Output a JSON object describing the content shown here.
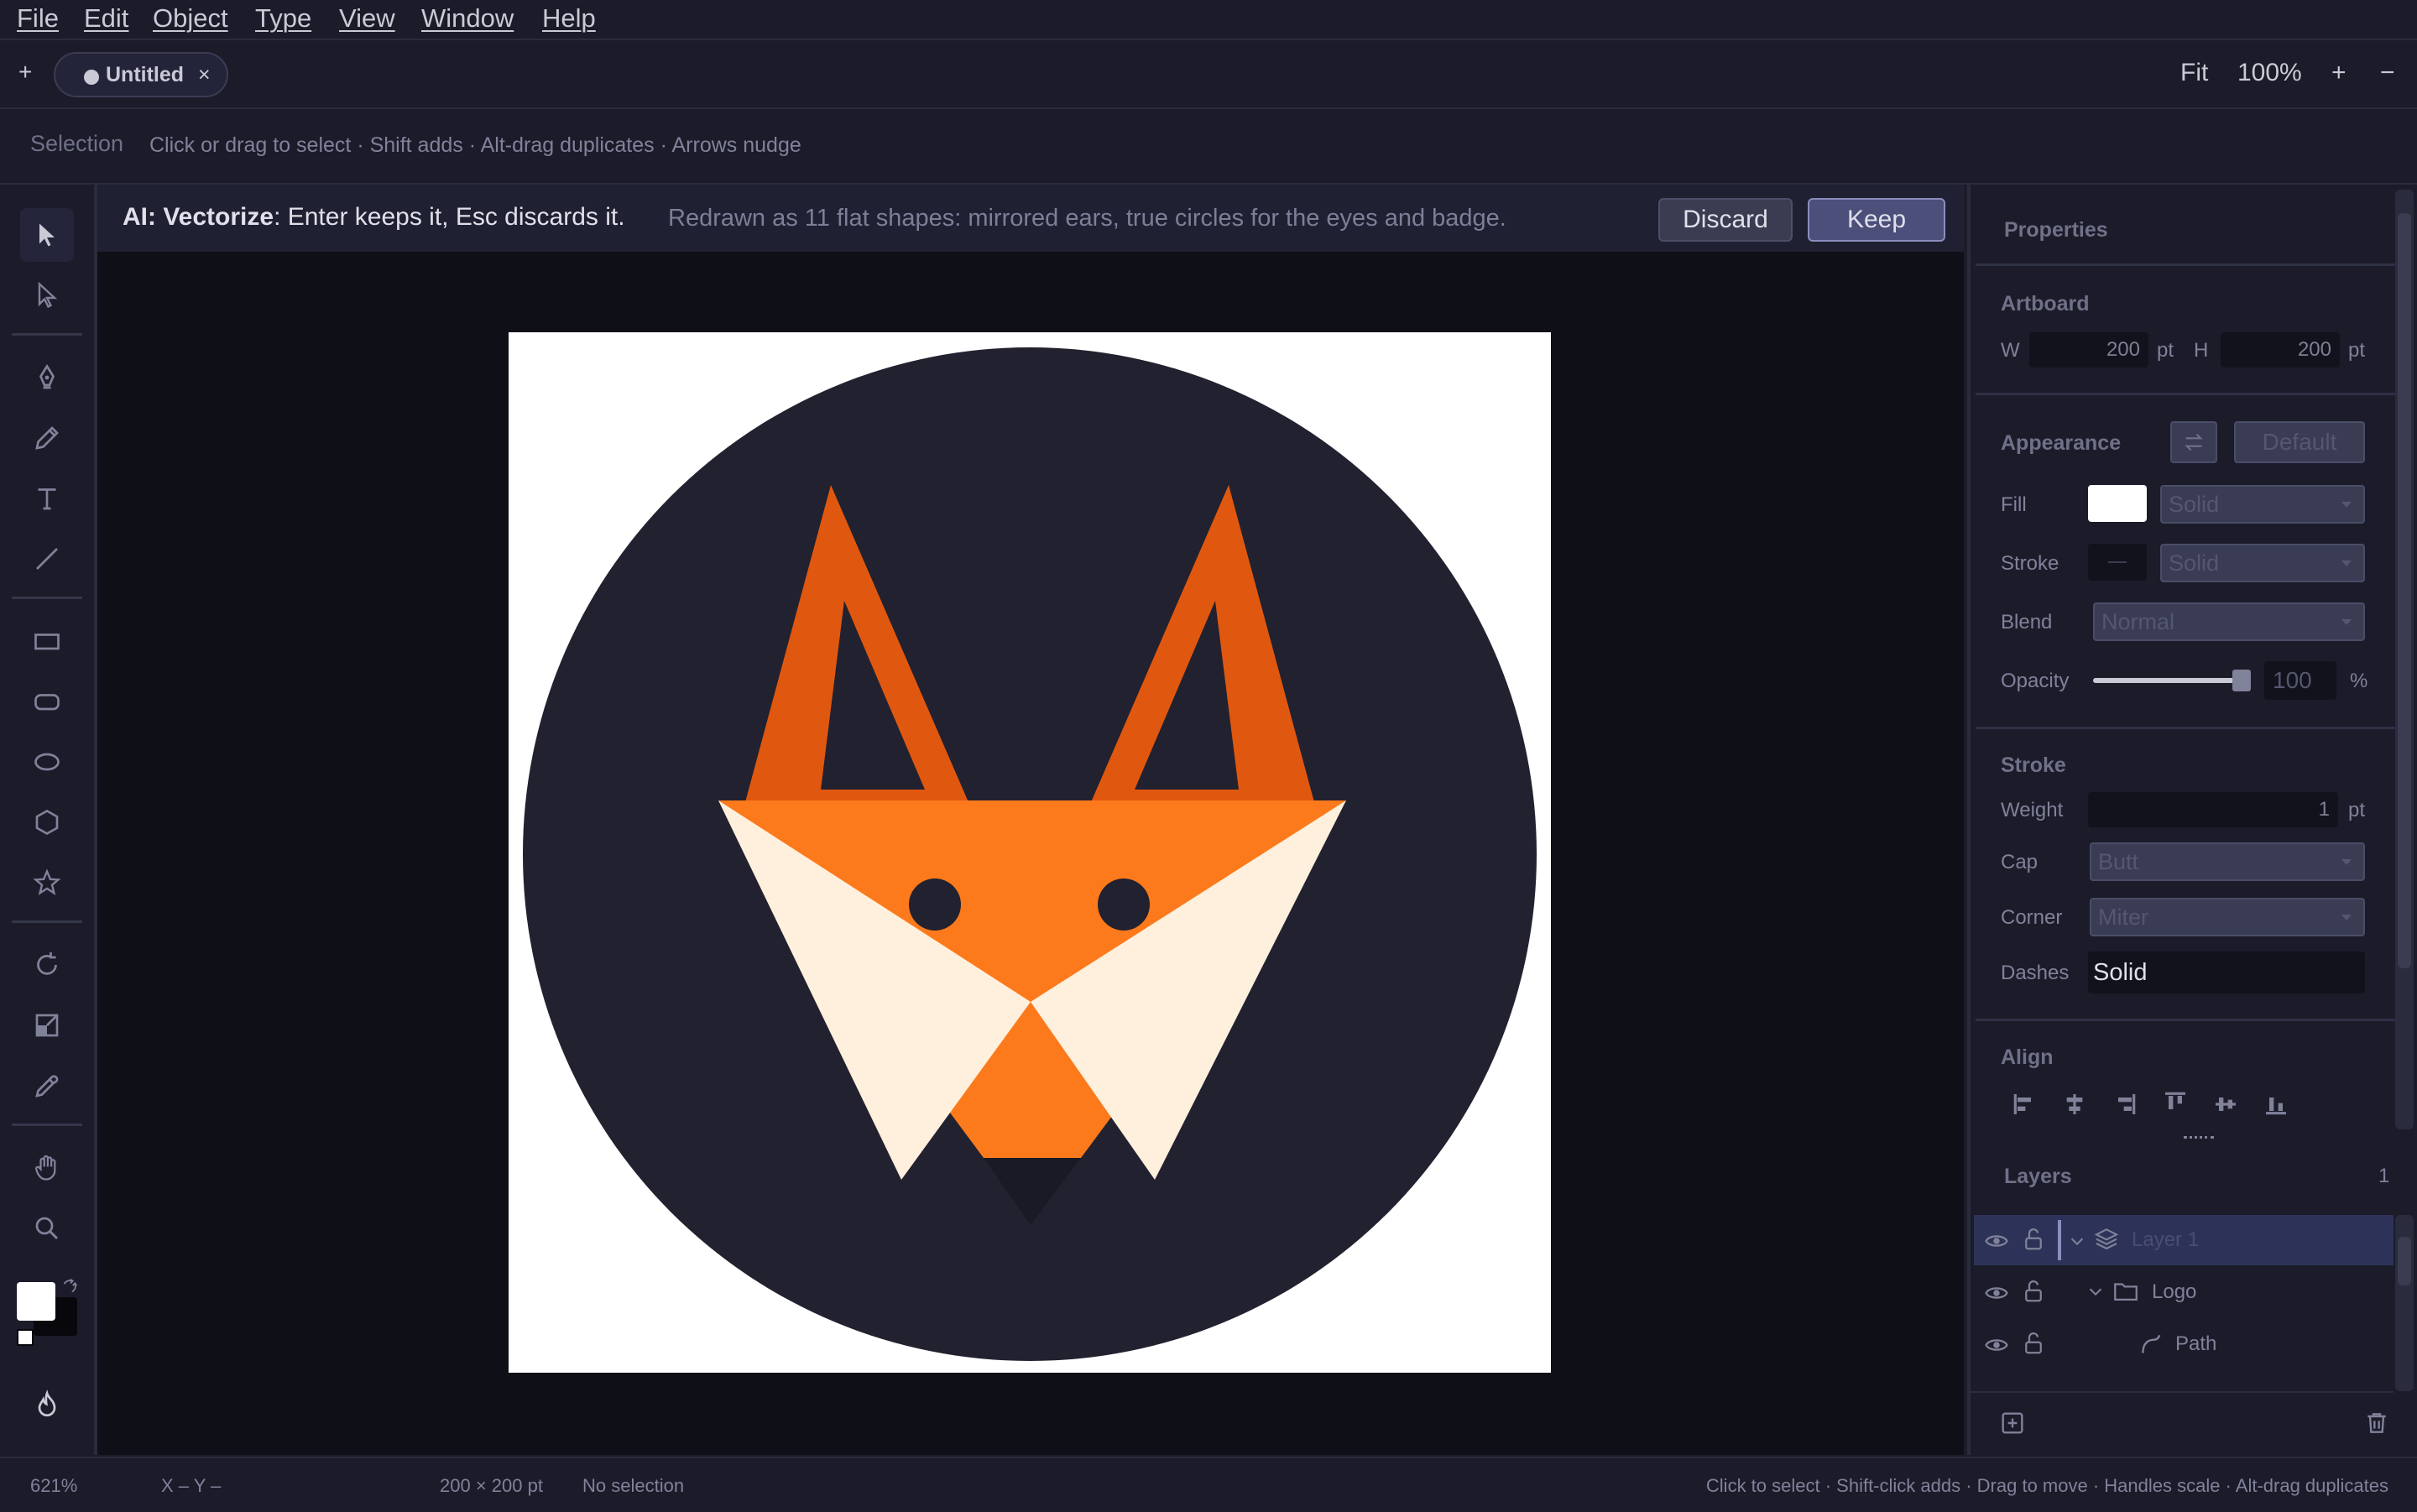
{
  "menubar": {
    "items": [
      "File",
      "Edit",
      "Object",
      "Type",
      "View",
      "Window",
      "Help"
    ]
  },
  "tabbar": {
    "add_label": "+",
    "tab_title": "Untitled",
    "tab_close": "×",
    "fit_label": "Fit",
    "zoom": "100%",
    "zoom_in": "+",
    "zoom_out": "−"
  },
  "hintbar": {
    "tool": "Selection",
    "hint": "Click or drag to select · Shift adds · Alt-drag duplicates · Arrows nudge"
  },
  "ai_bar": {
    "prefix": "AI: Vectorize",
    "instruction": ": Enter keeps it, Esc discards it.",
    "description": "Redrawn as 11 flat shapes: mirrored ears, true circles for the eyes and badge.",
    "discard_label": "Discard",
    "keep_label": "Keep"
  },
  "properties": {
    "title": "Properties",
    "artboard": {
      "label": "Artboard",
      "w_label": "W",
      "w_value": "200",
      "w_unit": "pt",
      "h_label": "H",
      "h_value": "200",
      "h_unit": "pt"
    },
    "appearance": {
      "label": "Appearance",
      "default_label": "Default",
      "fill_label": "Fill",
      "fill_type": "Solid",
      "fill_color": "#ffffff",
      "stroke_label": "Stroke",
      "stroke_type": "Solid",
      "blend_label": "Blend",
      "blend_value": "Normal",
      "opacity_label": "Opacity",
      "opacity_value": "100",
      "opacity_unit": "%"
    },
    "stroke": {
      "label": "Stroke",
      "weight_label": "Weight",
      "weight_value": "1",
      "weight_unit": "pt",
      "cap_label": "Cap",
      "cap_value": "Butt",
      "corner_label": "Corner",
      "corner_value": "Miter",
      "dashes_label": "Dashes",
      "dashes_value": "Solid"
    },
    "align": {
      "label": "Align"
    }
  },
  "layers": {
    "label": "Layers",
    "count": "1",
    "rows": [
      {
        "name": "Layer 1"
      },
      {
        "name": "Logo"
      },
      {
        "name": "Path"
      }
    ]
  },
  "statusbar": {
    "zoom": "621%",
    "coords": "X –  Y –",
    "size": "200 × 200 pt",
    "selection": "No selection",
    "hint": "Click to select · Shift-click adds · Drag to move · Handles scale · Alt-drag duplicates"
  },
  "colors": {
    "accent": "#56598a",
    "badge": "#22212f",
    "fox_orange": "#fc7a1c",
    "fox_dark_orange": "#e0580f",
    "fox_cream": "#fef0dd"
  }
}
